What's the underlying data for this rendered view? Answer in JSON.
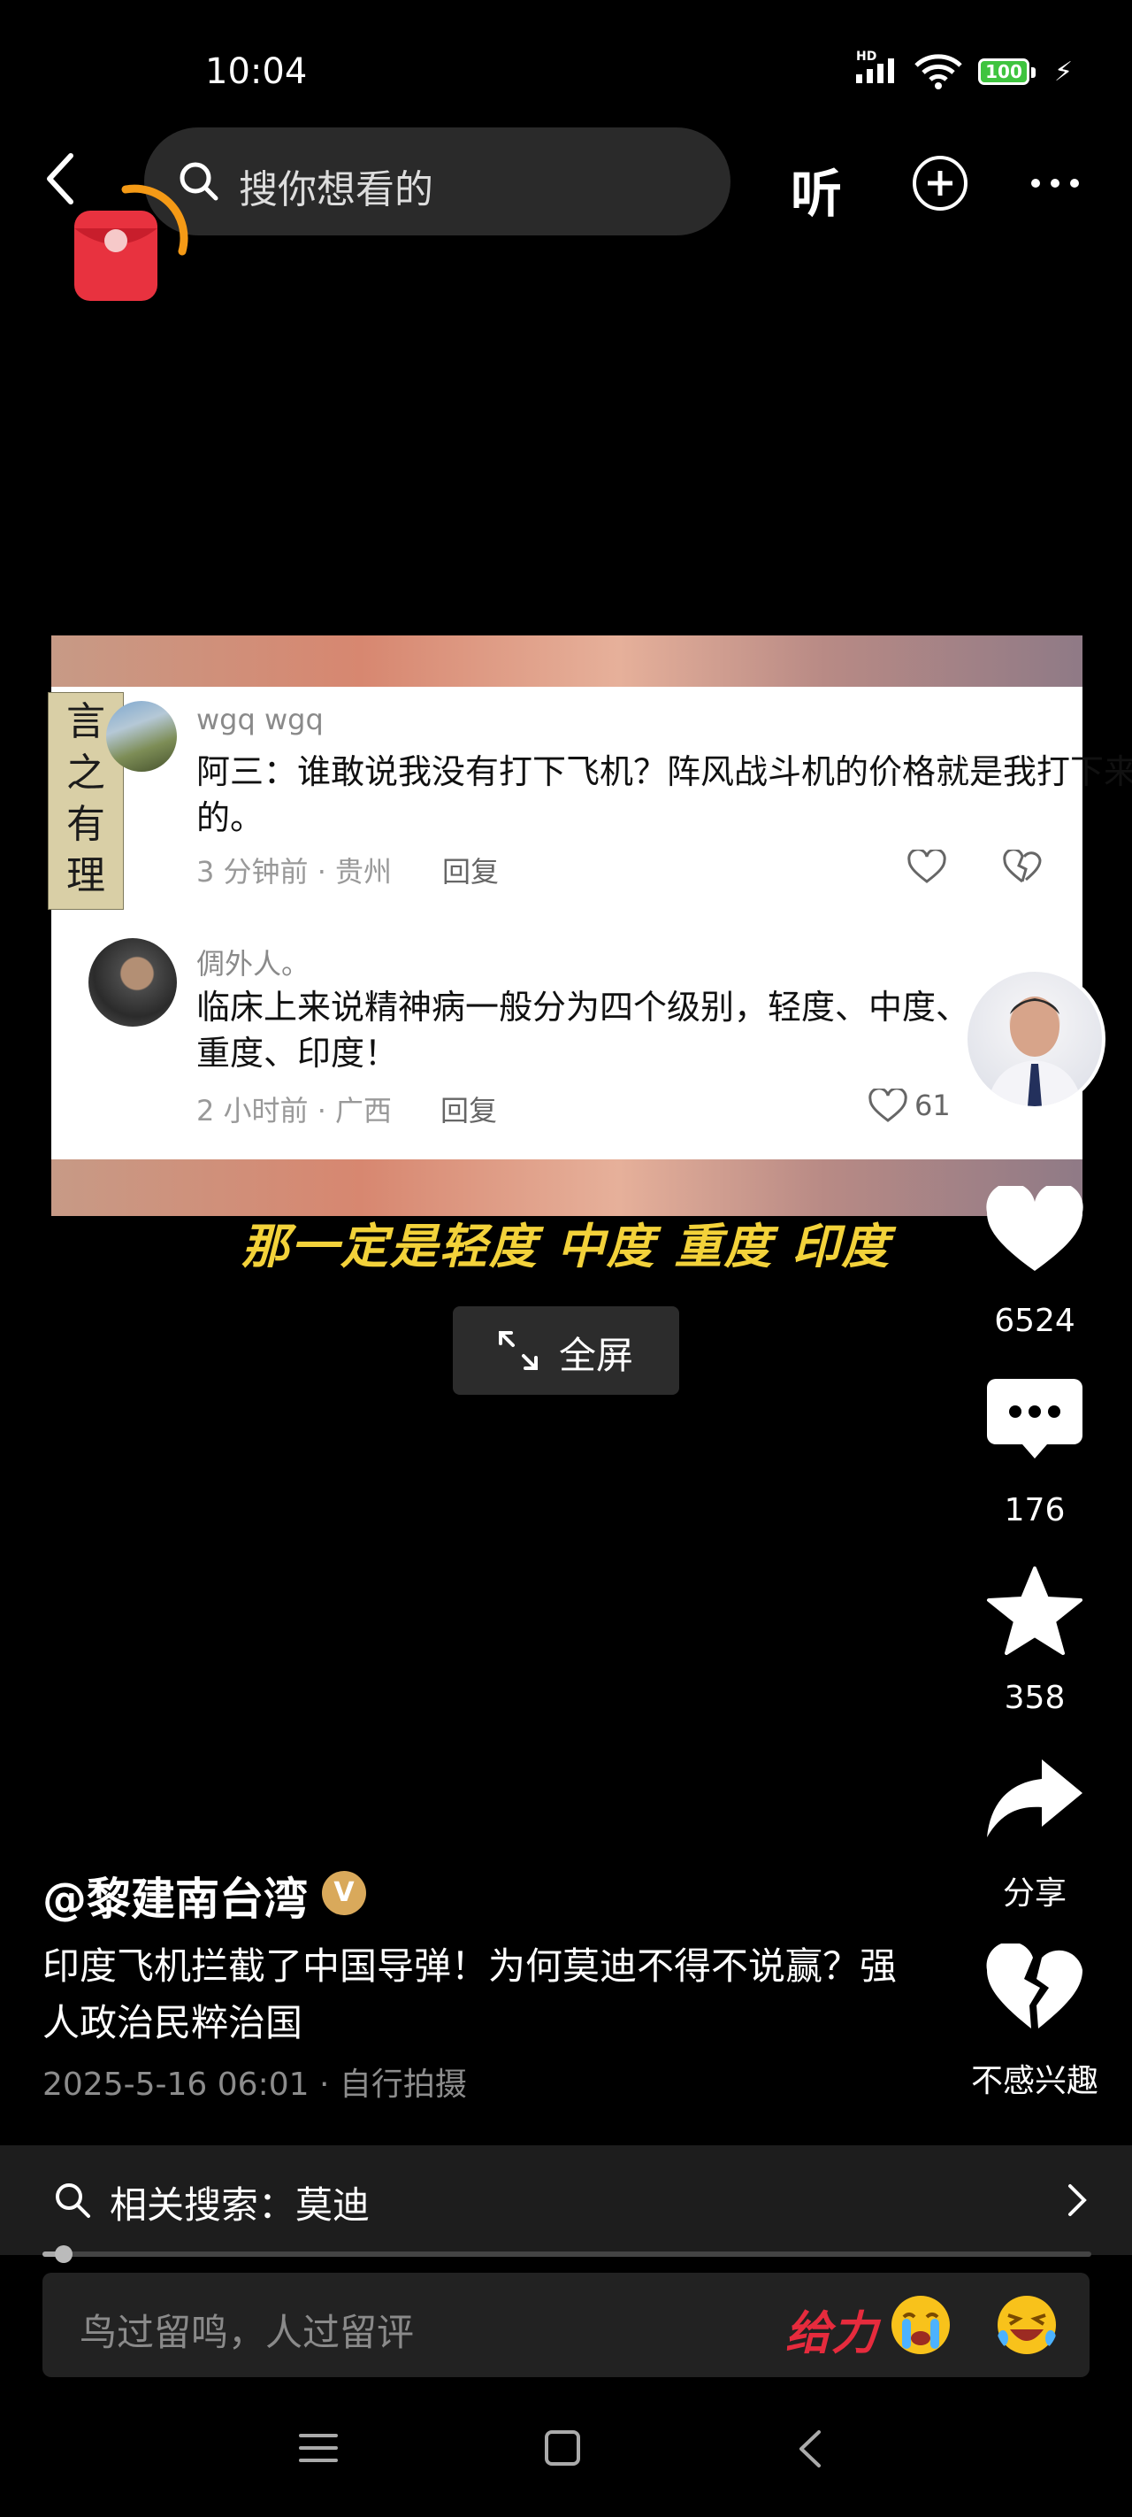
{
  "status_bar": {
    "time": "10:04",
    "network": "HD",
    "battery": "100"
  },
  "top_bar": {
    "search_placeholder": "搜你想看的",
    "listen_label": "听"
  },
  "video": {
    "bookmark_text": "言之有理",
    "comments": [
      {
        "name": "wgq  wgq",
        "text": "阿三：谁敢说我没有打下飞机？阵风战斗机的价格就是我打下来的。",
        "meta": "3 分钟前 · 贵州",
        "reply": "回复"
      },
      {
        "name": "倜外人。",
        "text": "临床上来说精神病一般分为四个级别，轻度、中度、重度、印度！",
        "meta": "2 小时前 · 广西",
        "reply": "回复",
        "likes": "61"
      }
    ],
    "subtitle": "那一定是轻度  中度  重度  印度",
    "fullscreen_label": "全屏"
  },
  "right_rail": {
    "likes": "6524",
    "comments": "176",
    "favorites": "358",
    "share_label": "分享",
    "dislike_label": "不感兴趣"
  },
  "post": {
    "author": "@黎建南台湾",
    "verified_badge": "V",
    "description": "印度飞机拦截了中国导弹！为何莫迪不得不说赢？强人政治民粹治国",
    "meta": "2025-5-16 06:01 · 自行拍摄"
  },
  "related_search": {
    "label": "相关搜索：莫迪"
  },
  "playback": {
    "progress_fraction": 0.02
  },
  "comment_input": {
    "placeholder": "鸟过留鸣，人过留评",
    "sticker_text": "给力"
  },
  "colors": {
    "subtitle": "#f3d23a",
    "accent_red": "#e62b3d",
    "battery_green": "#3fc43f"
  },
  "icons": [
    "back-icon",
    "search-icon",
    "add-icon",
    "more-icon",
    "heart-icon",
    "comment-icon",
    "star-icon",
    "share-icon",
    "broken-heart-icon",
    "menu-icon",
    "home-icon",
    "back-nav-icon"
  ]
}
